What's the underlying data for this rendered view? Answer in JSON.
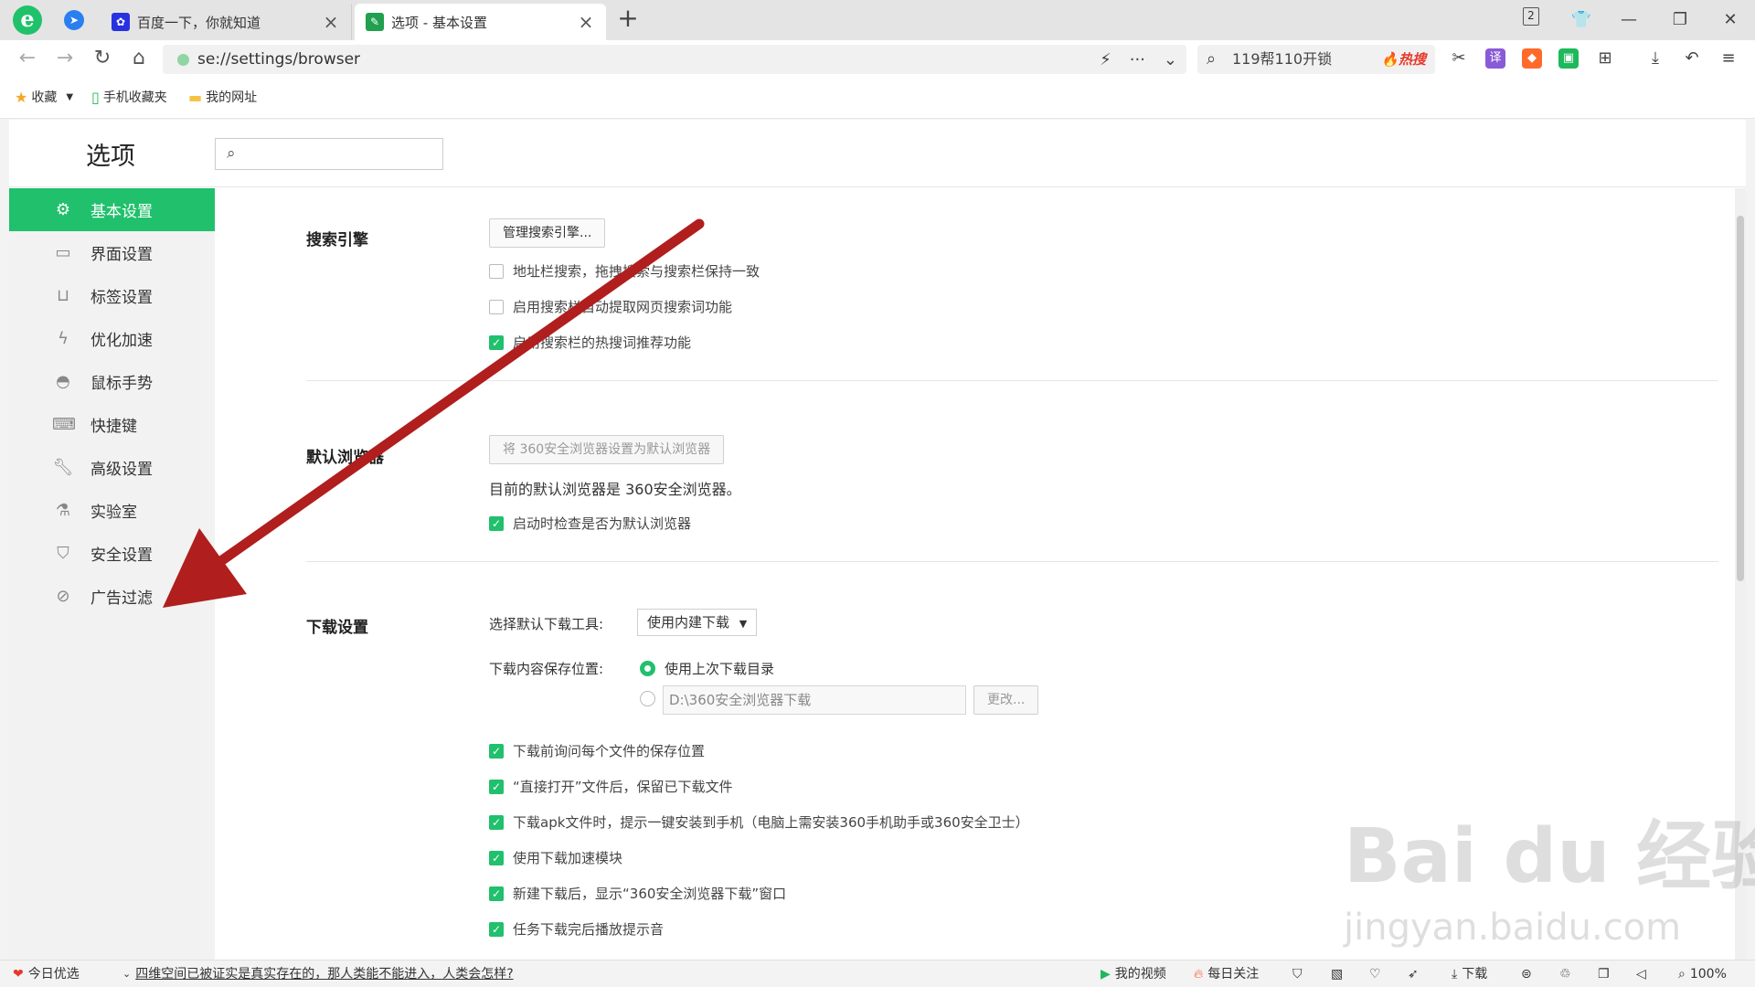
{
  "tabs": [
    {
      "title": "百度一下，你就知道",
      "favicon": "baidu-paw-icon"
    },
    {
      "title": "选项 - 基本设置",
      "favicon": "settings-wrench-icon"
    }
  ],
  "tab_count": "2",
  "toolbar": {
    "url": "se://settings/browser",
    "search_text": "119帮110开锁",
    "hot_label": "热搜",
    "translate_label": "译"
  },
  "bookmarks": [
    {
      "label": "收藏",
      "icon": "star-icon"
    },
    {
      "label": "手机收藏夹",
      "icon": "phone-icon"
    },
    {
      "label": "我的网址",
      "icon": "folder-icon"
    }
  ],
  "page": {
    "title": "选项",
    "search_placeholder": ""
  },
  "sidebar": {
    "items": [
      {
        "label": "基本设置",
        "icon": "gear-icon"
      },
      {
        "label": "界面设置",
        "icon": "window-icon"
      },
      {
        "label": "标签设置",
        "icon": "tab-icon"
      },
      {
        "label": "优化加速",
        "icon": "lightning-icon"
      },
      {
        "label": "鼠标手势",
        "icon": "mouse-icon"
      },
      {
        "label": "快捷键",
        "icon": "keyboard-icon"
      },
      {
        "label": "高级设置",
        "icon": "wrench-icon"
      },
      {
        "label": "实验室",
        "icon": "flask-icon"
      },
      {
        "label": "安全设置",
        "icon": "shield-icon"
      },
      {
        "label": "广告过滤",
        "icon": "block-icon"
      }
    ],
    "active_index": 0
  },
  "search_engine": {
    "title": "搜索引擎",
    "manage_button": "管理搜索引擎...",
    "options": [
      {
        "label": "地址栏搜索，拖拽搜索与搜索栏保持一致",
        "checked": false
      },
      {
        "label": "启用搜索栏自动提取网页搜索词功能",
        "checked": false
      },
      {
        "label": "启用搜索栏的热搜词推荐功能",
        "checked": true
      }
    ]
  },
  "default_browser": {
    "title": "默认浏览器",
    "set_button": "将 360安全浏览器设置为默认浏览器",
    "current_text": "目前的默认浏览器是 360安全浏览器。",
    "options": [
      {
        "label": "启动时检查是否为默认浏览器",
        "checked": true
      }
    ]
  },
  "download": {
    "title": "下载设置",
    "tool_label": "选择默认下载工具:",
    "tool_value": "使用内建下载",
    "location_label": "下载内容保存位置:",
    "radio_last": "使用上次下载目录",
    "path_value": "D:\\360安全浏览器下载",
    "change_button": "更改...",
    "options": [
      {
        "label": "下载前询问每个文件的保存位置",
        "checked": true
      },
      {
        "label": "“直接打开”文件后，保留已下载文件",
        "checked": true
      },
      {
        "label": "下载apk文件时，提示一键安装到手机（电脑上需安装360手机助手或360安全卫士）",
        "checked": true
      },
      {
        "label": "使用下载加速模块",
        "checked": true
      },
      {
        "label": "新建下载后，显示“360安全浏览器下载”窗口",
        "checked": true
      },
      {
        "label": "任务下载完后播放提示音",
        "checked": true
      }
    ]
  },
  "statusbar": {
    "today": "今日优选",
    "news": "四维空间已被证实是真实存在的，那人类能不能进入，人类会怎样?",
    "video": "我的视频",
    "follow": "每日关注",
    "download": "下载",
    "zoom": "100%"
  },
  "watermark": {
    "line1": "Bai du 经验",
    "line2": "jingyan.baidu.com"
  },
  "colors": {
    "accent": "#21c06c",
    "arrow": "#b01e1e",
    "hot": "#e8382b"
  }
}
